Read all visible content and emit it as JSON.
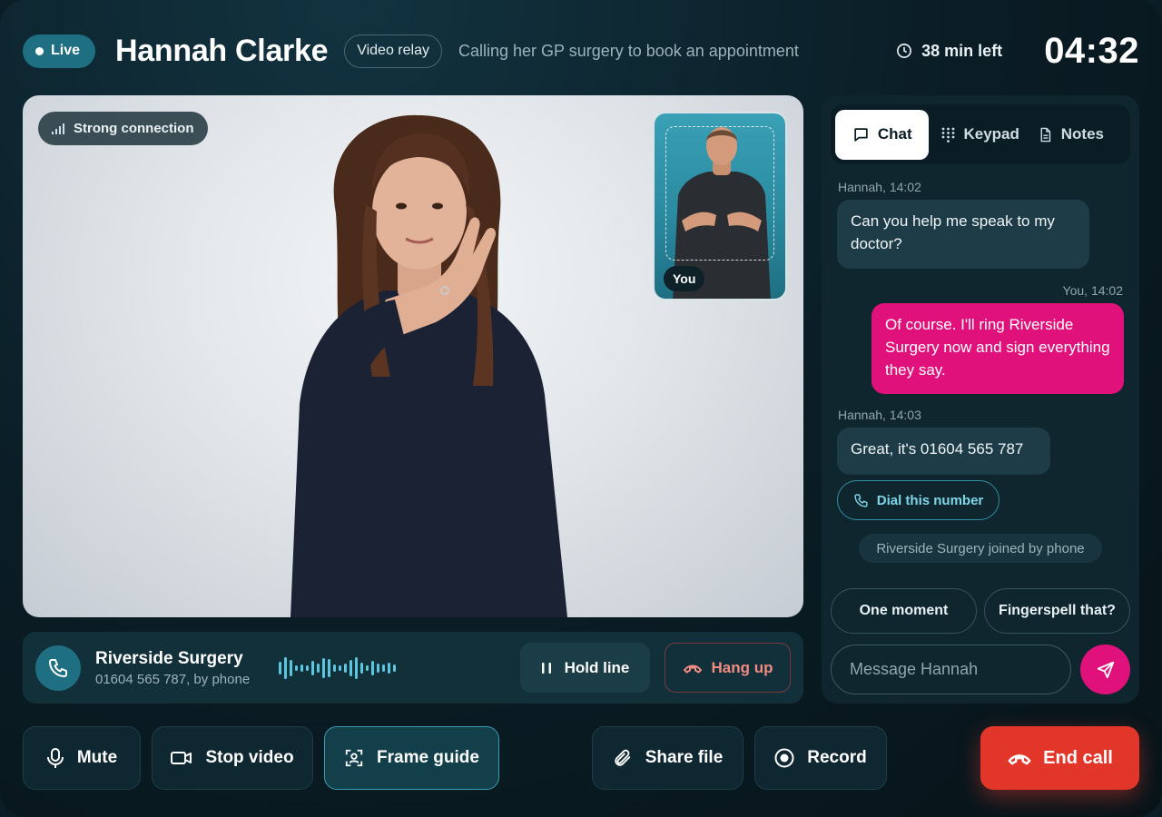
{
  "header": {
    "live_label": "Live",
    "caller_name": "Hannah Clarke",
    "mode_label": "Video relay",
    "description": "Calling her GP surgery to book an appointment",
    "time_left": "38 min left",
    "elapsed": "04:32"
  },
  "video": {
    "connection_label": "Strong connection",
    "self_view_label": "You"
  },
  "phone_line": {
    "name": "Riverside Surgery",
    "detail": "01604 565 787, by phone",
    "hold_label": "Hold line",
    "hangup_label": "Hang up"
  },
  "side_panel": {
    "tabs": [
      {
        "label": "Chat",
        "icon": "chat-bubble-icon",
        "active": true
      },
      {
        "label": "Keypad",
        "icon": "keypad-icon",
        "active": false
      },
      {
        "label": "Notes",
        "icon": "document-icon",
        "active": false
      }
    ],
    "messages": [
      {
        "meta": "Hannah, 14:02",
        "text": "Can you help me speak to my doctor?",
        "from": "them"
      },
      {
        "meta": "You, 14:02",
        "text": "Of course. I'll ring Riverside Surgery now and sign everything they say.",
        "from": "me"
      },
      {
        "meta": "Hannah, 14:03",
        "text": "Great, it's 01604 565 787",
        "from": "them"
      }
    ],
    "dial_action": "Dial this number",
    "system_note": "Riverside Surgery joined by phone",
    "quick_replies": [
      "One moment",
      "Fingerspell that?"
    ],
    "input_placeholder": "Message Hannah"
  },
  "controls": {
    "mute": "Mute",
    "stop_video": "Stop video",
    "frame_guide": "Frame guide",
    "share_file": "Share file",
    "record": "Record",
    "end_call": "End call"
  },
  "colors": {
    "accent_teal": "#1f6f82",
    "accent_pink": "#e0117a",
    "end_red": "#e3362b"
  }
}
